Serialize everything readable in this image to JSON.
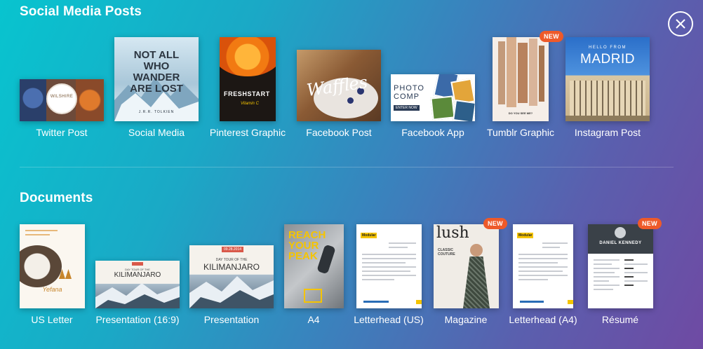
{
  "sections": {
    "social": {
      "title": "Social Media Posts",
      "items": [
        {
          "label": "Twitter Post"
        },
        {
          "label": "Social Media",
          "thumb_text": "NOT ALL WHO WANDER ARE LOST",
          "thumb_sub": "J.R.R. TOLKIEN"
        },
        {
          "label": "Pinterest Graphic",
          "thumb_text": "FRESHSTART",
          "thumb_sub": "Vitamin C"
        },
        {
          "label": "Facebook Post",
          "thumb_text": "Waffles"
        },
        {
          "label": "Facebook App",
          "thumb_text": "PHOTO COMP",
          "thumb_sub": "ENTER NOW"
        },
        {
          "label": "Tumblr Graphic",
          "badge": "NEW",
          "thumb_sub": "DO YOU SEE ME?"
        },
        {
          "label": "Instagram Post",
          "thumb_text": "MADRID",
          "thumb_sub": "HELLO FROM"
        }
      ]
    },
    "documents": {
      "title": "Documents",
      "items": [
        {
          "label": "US Letter",
          "thumb_text": "Yefana"
        },
        {
          "label": "Presentation (16:9)",
          "thumb_text": "KILIMANJARO",
          "thumb_sub": "DAY TOUR OF THE"
        },
        {
          "label": "Presentation",
          "thumb_text": "KILIMANJARO",
          "thumb_sub": "DAY TOUR OF THE",
          "thumb_date": "09.28.2014"
        },
        {
          "label": "A4",
          "thumb_text": "REACH YOUR PEAK"
        },
        {
          "label": "Letterhead (US)",
          "thumb_text": "Modular"
        },
        {
          "label": "Magazine",
          "badge": "NEW",
          "thumb_text": "lush",
          "thumb_sub": "CLASSIC COUTURE"
        },
        {
          "label": "Letterhead (A4)",
          "thumb_text": "Modular"
        },
        {
          "label": "Résumé",
          "badge": "NEW",
          "thumb_text": "DANIEL KENNEDY"
        }
      ]
    }
  },
  "colors": {
    "badge": "#ee5a2a",
    "accent_yellow": "#f5c400"
  },
  "icons": {
    "close": "close-icon"
  }
}
